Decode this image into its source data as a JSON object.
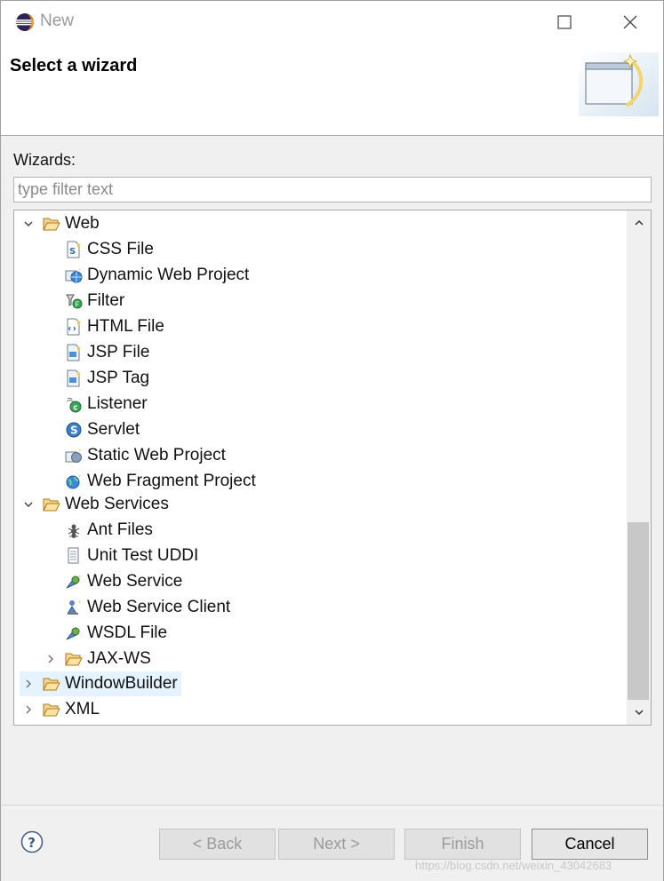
{
  "window": {
    "title": "New",
    "controls": {
      "maximize_icon": "maximize-icon",
      "close_icon": "close-icon"
    }
  },
  "header": {
    "title": "Select a wizard",
    "banner_icon": "wizard-banner-icon"
  },
  "wizards": {
    "label": "Wizards:",
    "filter_placeholder": "type filter text",
    "filter_value": ""
  },
  "tree": {
    "items": [
      {
        "label": "Web",
        "type": "folder",
        "expanded": true,
        "depth": 0,
        "icon": "folder-open-icon"
      },
      {
        "label": "CSS File",
        "type": "leaf",
        "depth": 1,
        "icon": "css-file-icon"
      },
      {
        "label": "Dynamic Web Project",
        "type": "leaf",
        "depth": 1,
        "icon": "dynamic-web-project-icon"
      },
      {
        "label": "Filter",
        "type": "leaf",
        "depth": 1,
        "icon": "filter-icon"
      },
      {
        "label": "HTML File",
        "type": "leaf",
        "depth": 1,
        "icon": "html-file-icon"
      },
      {
        "label": "JSP File",
        "type": "leaf",
        "depth": 1,
        "icon": "jsp-file-icon"
      },
      {
        "label": "JSP Tag",
        "type": "leaf",
        "depth": 1,
        "icon": "jsp-tag-icon"
      },
      {
        "label": "Listener",
        "type": "leaf",
        "depth": 1,
        "icon": "listener-icon"
      },
      {
        "label": "Servlet",
        "type": "leaf",
        "depth": 1,
        "icon": "servlet-icon"
      },
      {
        "label": "Static Web Project",
        "type": "leaf",
        "depth": 1,
        "icon": "static-web-project-icon"
      },
      {
        "label": "Web Fragment Project",
        "type": "leaf",
        "depth": 1,
        "icon": "web-fragment-project-icon"
      },
      {
        "label": "Web Services",
        "type": "folder",
        "expanded": true,
        "depth": 0,
        "icon": "folder-open-icon"
      },
      {
        "label": "Ant Files",
        "type": "leaf",
        "depth": 1,
        "icon": "ant-files-icon"
      },
      {
        "label": "Unit Test UDDI",
        "type": "leaf",
        "depth": 1,
        "icon": "unit-test-uddi-icon"
      },
      {
        "label": "Web Service",
        "type": "leaf",
        "depth": 1,
        "icon": "web-service-icon"
      },
      {
        "label": "Web Service Client",
        "type": "leaf",
        "depth": 1,
        "icon": "web-service-client-icon"
      },
      {
        "label": "WSDL File",
        "type": "leaf",
        "depth": 1,
        "icon": "wsdl-file-icon"
      },
      {
        "label": "JAX-WS",
        "type": "folder",
        "expanded": false,
        "depth": 1,
        "icon": "folder-icon"
      },
      {
        "label": "WindowBuilder",
        "type": "folder",
        "expanded": false,
        "depth": 0,
        "icon": "folder-icon",
        "selected": true
      },
      {
        "label": "XML",
        "type": "folder",
        "expanded": false,
        "depth": 0,
        "icon": "folder-icon"
      }
    ],
    "scroll_position": 0.7
  },
  "footer": {
    "help_icon": "help-icon",
    "back_label": "< Back",
    "next_label": "Next >",
    "finish_label": "Finish",
    "cancel_label": "Cancel",
    "watermark": "https://blog.csdn.net/weixin_43042683"
  },
  "colors": {
    "folder": "#e8a33c",
    "selection": "#e5f3ff",
    "disabled_text": "#9b9b9b"
  }
}
